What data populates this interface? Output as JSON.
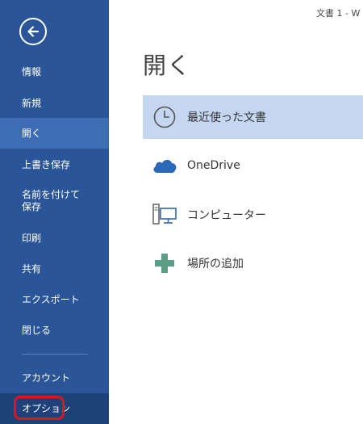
{
  "window": {
    "title": "文書 1 - W"
  },
  "sidebar": {
    "items": [
      {
        "label": "情報"
      },
      {
        "label": "新規"
      },
      {
        "label": "開く"
      },
      {
        "label": "上書き保存"
      },
      {
        "label": "名前を付けて\n保存"
      },
      {
        "label": "印刷"
      },
      {
        "label": "共有"
      },
      {
        "label": "エクスポート"
      },
      {
        "label": "閉じる"
      },
      {
        "label": "アカウント"
      },
      {
        "label": "オプション"
      }
    ],
    "selected_index": 2
  },
  "main": {
    "title": "開く",
    "places": [
      {
        "label": "最近使った文書",
        "icon": "clock-icon"
      },
      {
        "label": "OneDrive",
        "icon": "cloud-icon"
      },
      {
        "label": "コンピューター",
        "icon": "computer-icon"
      },
      {
        "label": "場所の追加",
        "icon": "plus-icon"
      }
    ]
  },
  "colors": {
    "sidebar": "#2a5699",
    "sidebar_selected": "#3e6db5",
    "place_selected": "#c5d7f0",
    "highlight": "#e0141e"
  }
}
